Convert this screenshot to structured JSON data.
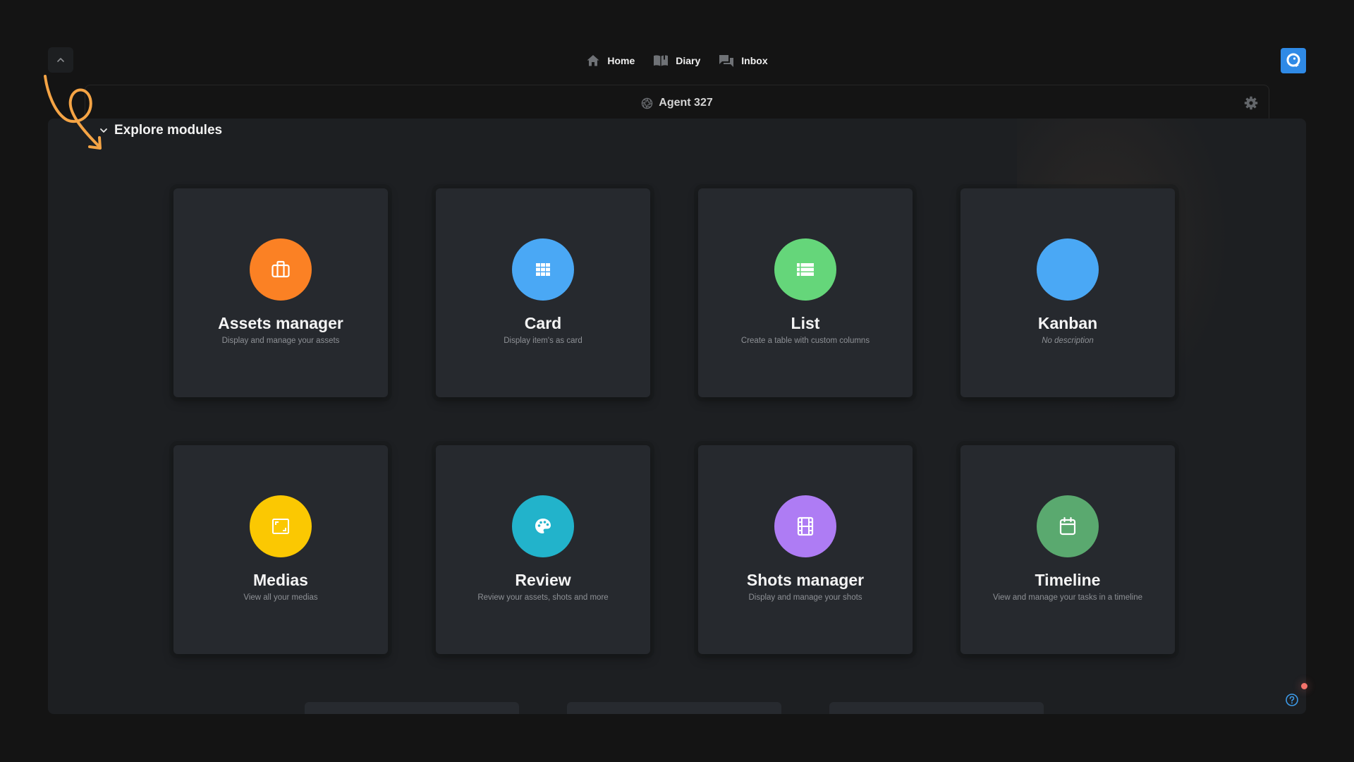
{
  "nav": {
    "collapse_icon": "chevron-up-icon",
    "items": [
      {
        "label": "Home",
        "icon": "home-icon"
      },
      {
        "label": "Diary",
        "icon": "book-open-icon"
      },
      {
        "label": "Inbox",
        "icon": "chat-icon"
      }
    ],
    "brand_icon": "chat-bubble-logo-icon"
  },
  "header": {
    "title": "Agent 327",
    "title_icon": "aperture-icon",
    "settings_icon": "gear-icon"
  },
  "section": {
    "title": "Explore modules",
    "expanded": true
  },
  "modules": [
    {
      "title": "Assets manager",
      "description": "Display and manage your assets",
      "icon": "briefcase-icon",
      "color": "#fb8124",
      "italic": false
    },
    {
      "title": "Card",
      "description": "Display item's as card",
      "icon": "grid-icon",
      "color": "#4aa8f5",
      "italic": false
    },
    {
      "title": "List",
      "description": "Create a table with custom columns",
      "icon": "list-icon",
      "color": "#65d67a",
      "italic": false
    },
    {
      "title": "Kanban",
      "description": "No description",
      "icon": "none",
      "color": "#4aa8f5",
      "italic": true
    },
    {
      "title": "Medias",
      "description": "View all your medias",
      "icon": "image-frame-icon",
      "color": "#fbc802",
      "italic": false
    },
    {
      "title": "Review",
      "description": "Review your assets, shots and more",
      "icon": "palette-icon",
      "color": "#22b3cb",
      "italic": false
    },
    {
      "title": "Shots manager",
      "description": "Display and manage your shots",
      "icon": "film-icon",
      "color": "#ae7cf4",
      "italic": false
    },
    {
      "title": "Timeline",
      "description": "View and manage your tasks in a timeline",
      "icon": "calendar-icon",
      "color": "#5aa96f",
      "italic": false
    }
  ],
  "footer": {
    "help_icon": "help-circle-icon",
    "notification_dot_color": "#f4736b"
  },
  "annotation": {
    "color": "#f5a445",
    "icon": "hand-drawn-arrow-icon"
  }
}
